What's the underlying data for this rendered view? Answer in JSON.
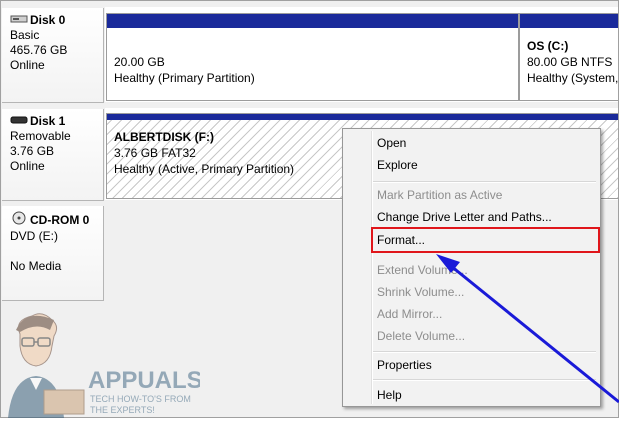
{
  "disks": [
    {
      "name": "Disk 0",
      "type": "Basic",
      "size": "465.76 GB",
      "status": "Online",
      "icon": "hard-disk-icon"
    },
    {
      "name": "Disk 1",
      "type": "Removable",
      "size": "3.76 GB",
      "status": "Online",
      "icon": "removable-disk-icon"
    },
    {
      "name": "CD-ROM 0",
      "type": "DVD (E:)",
      "size": "",
      "status": "No Media",
      "icon": "cdrom-icon"
    }
  ],
  "partitions": {
    "disk0_p1": {
      "size": "20.00 GB",
      "health": "Healthy (Primary Partition)"
    },
    "disk0_p2": {
      "name": "OS  (C:)",
      "size": "80.00 GB NTFS",
      "health": "Healthy (System,"
    },
    "disk1_p1": {
      "name": "ALBERTDISK  (F:)",
      "size": "3.76 GB FAT32",
      "health": "Healthy (Active, Primary Partition)"
    }
  },
  "context_menu": {
    "items": [
      {
        "label": "Open",
        "enabled": true
      },
      {
        "label": "Explore",
        "enabled": true
      },
      {
        "label": "Mark Partition as Active",
        "enabled": false
      },
      {
        "label": "Change Drive Letter and Paths...",
        "enabled": true
      },
      {
        "label": "Format...",
        "enabled": true
      },
      {
        "label": "Extend Volume...",
        "enabled": false
      },
      {
        "label": "Shrink Volume...",
        "enabled": false
      },
      {
        "label": "Add Mirror...",
        "enabled": false
      },
      {
        "label": "Delete Volume...",
        "enabled": false
      },
      {
        "label": "Properties",
        "enabled": true
      },
      {
        "label": "Help",
        "enabled": true
      }
    ]
  },
  "watermark": {
    "brand": "APPUALS",
    "tagline": "TECH HOW-TO'S FROM",
    "tagline2": "THE EXPERTS!"
  },
  "colors": {
    "partition_bar": "#1a2a9a",
    "highlight": "#e0161b",
    "arrow": "#1a1ad8"
  }
}
